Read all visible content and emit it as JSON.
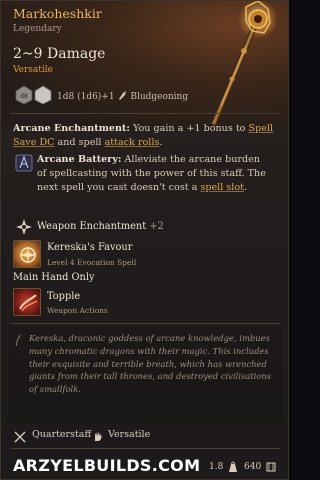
{
  "item": {
    "name": "Markoheshkir",
    "rarity": "Legendary",
    "damage": "2~9 Damage",
    "property": "Versatile",
    "damage_line_prefix": "1d8 (1d6)+1",
    "damage_type": "Bludgeoning"
  },
  "enchantment": {
    "title": "Arcane Enchantment:",
    "text_1": " You gain a +1 bonus to ",
    "link_1": "Spell Save DC",
    "text_2": " and spell ",
    "link_2": "attack rolls",
    "text_3": "."
  },
  "battery": {
    "title": "Arcane Battery:",
    "text_1": " Alleviate the arcane burden of spellcasting with the power of this staff. The next spell you cast doesn't cost a ",
    "link": "spell slot",
    "text_2": "."
  },
  "weapon_enchantment": {
    "label": "Weapon Enchantment",
    "value": "+2"
  },
  "spell_action": {
    "title": "Kereska's Favour",
    "subtitle": "Level 4 Evocation Spell"
  },
  "main_hand": "Main Hand Only",
  "weapon_action": {
    "title": "Topple",
    "subtitle": "Weapon Actions"
  },
  "lore": "Kereska, draconic goddess of arcane knowledge, imbues many chromatic dragons with their magic. This includes their exquisite and terrible breath, which has wrenched giants from their tall thrones, and destroyed civilisations of smallfolk.",
  "footer": {
    "proficiency": "Quarterstaff",
    "property": "Versatile"
  },
  "watermark": "ARZYELBUILDS.COM",
  "weight": "1.8",
  "price": "640",
  "colors": {
    "name_gold": "#e9b662",
    "highlight": "#e0a94a",
    "versatile_orange": "#d99a3e"
  }
}
